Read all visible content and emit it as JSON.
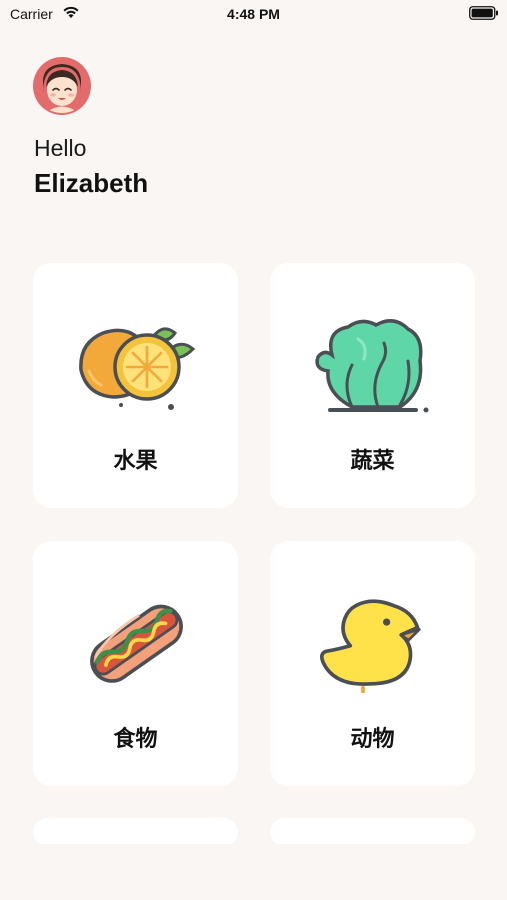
{
  "status_bar": {
    "carrier": "Carrier",
    "time": "4:48 PM"
  },
  "greeting": {
    "hello": "Hello",
    "name": "Elizabeth"
  },
  "categories": [
    {
      "label": "水果",
      "icon": "fruit-icon"
    },
    {
      "label": "蔬菜",
      "icon": "vegetable-icon"
    },
    {
      "label": "食物",
      "icon": "food-icon"
    },
    {
      "label": "动物",
      "icon": "animal-icon"
    }
  ],
  "colors": {
    "background": "#f9f6f3",
    "card": "#ffffff",
    "outline": "#4a4f55"
  }
}
